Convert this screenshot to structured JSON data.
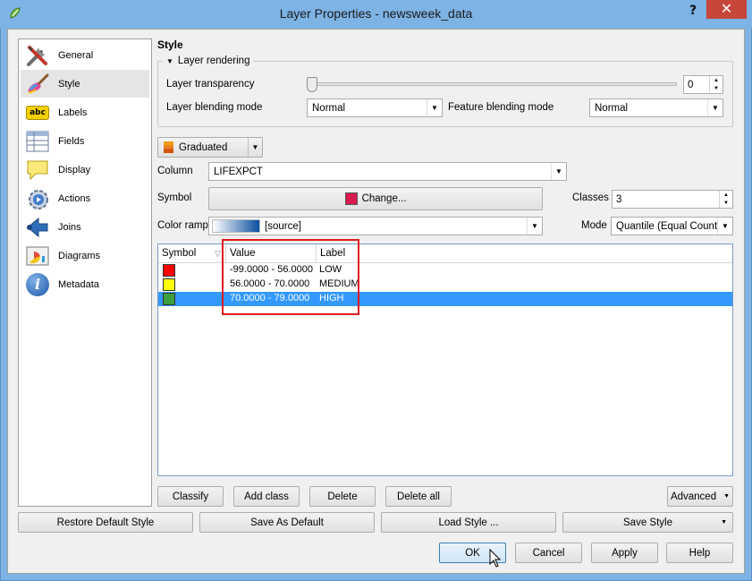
{
  "window": {
    "title": "Layer Properties - newsweek_data",
    "help_glyph": "?",
    "close_glyph": "✕"
  },
  "sidebar": {
    "items": [
      {
        "label": "General",
        "icon": "tools-icon"
      },
      {
        "label": "Style",
        "icon": "paintbrush-icon"
      },
      {
        "label": "Labels",
        "icon": "abc-label-icon",
        "badge": "abc"
      },
      {
        "label": "Fields",
        "icon": "table-fields-icon"
      },
      {
        "label": "Display",
        "icon": "speech-bubble-icon"
      },
      {
        "label": "Actions",
        "icon": "gear-play-icon"
      },
      {
        "label": "Joins",
        "icon": "join-arrow-icon"
      },
      {
        "label": "Diagrams",
        "icon": "diagram-icon"
      },
      {
        "label": "Metadata",
        "icon": "info-icon",
        "badge": "i"
      }
    ],
    "selected": "Style"
  },
  "style": {
    "heading": "Style",
    "layer_rendering": {
      "title": "Layer rendering",
      "transparency_label": "Layer transparency",
      "transparency_value": "0",
      "blending_label": "Layer blending mode",
      "blending_value": "Normal",
      "feature_blending_label": "Feature blending mode",
      "feature_blending_value": "Normal"
    },
    "renderer": "Graduated",
    "column_label": "Column",
    "column_value": "LIFEXPCT",
    "symbol_label": "Symbol",
    "change_button": "Change...",
    "classes_label": "Classes",
    "classes_value": "3",
    "color_ramp_label": "Color ramp",
    "color_ramp_value": "[source]",
    "mode_label": "Mode",
    "mode_value": "Quantile (Equal Count)",
    "table": {
      "headers": [
        "Symbol",
        "Value",
        "Label"
      ],
      "rows": [
        {
          "color": "#ff0000",
          "value": "-99.0000 - 56.0000",
          "label": "LOW"
        },
        {
          "color": "#ffff00",
          "value": "56.0000 - 70.0000",
          "label": "MEDIUM"
        },
        {
          "color": "#3e9f3e",
          "value": "70.0000 - 79.0000",
          "label": "HIGH"
        }
      ]
    },
    "buttons": {
      "classify": "Classify",
      "add_class": "Add class",
      "delete": "Delete",
      "delete_all": "Delete all",
      "advanced": "Advanced"
    }
  },
  "footer": {
    "restore_default": "Restore Default Style",
    "save_as_default": "Save As Default",
    "load_style": "Load Style ...",
    "save_style": "Save Style",
    "ok": "OK",
    "cancel": "Cancel",
    "apply": "Apply",
    "help": "Help"
  },
  "colors": {
    "titlebar": "#7db3e5",
    "close": "#c7463b",
    "selection": "#3399ff",
    "annotation": "#e0191f"
  }
}
